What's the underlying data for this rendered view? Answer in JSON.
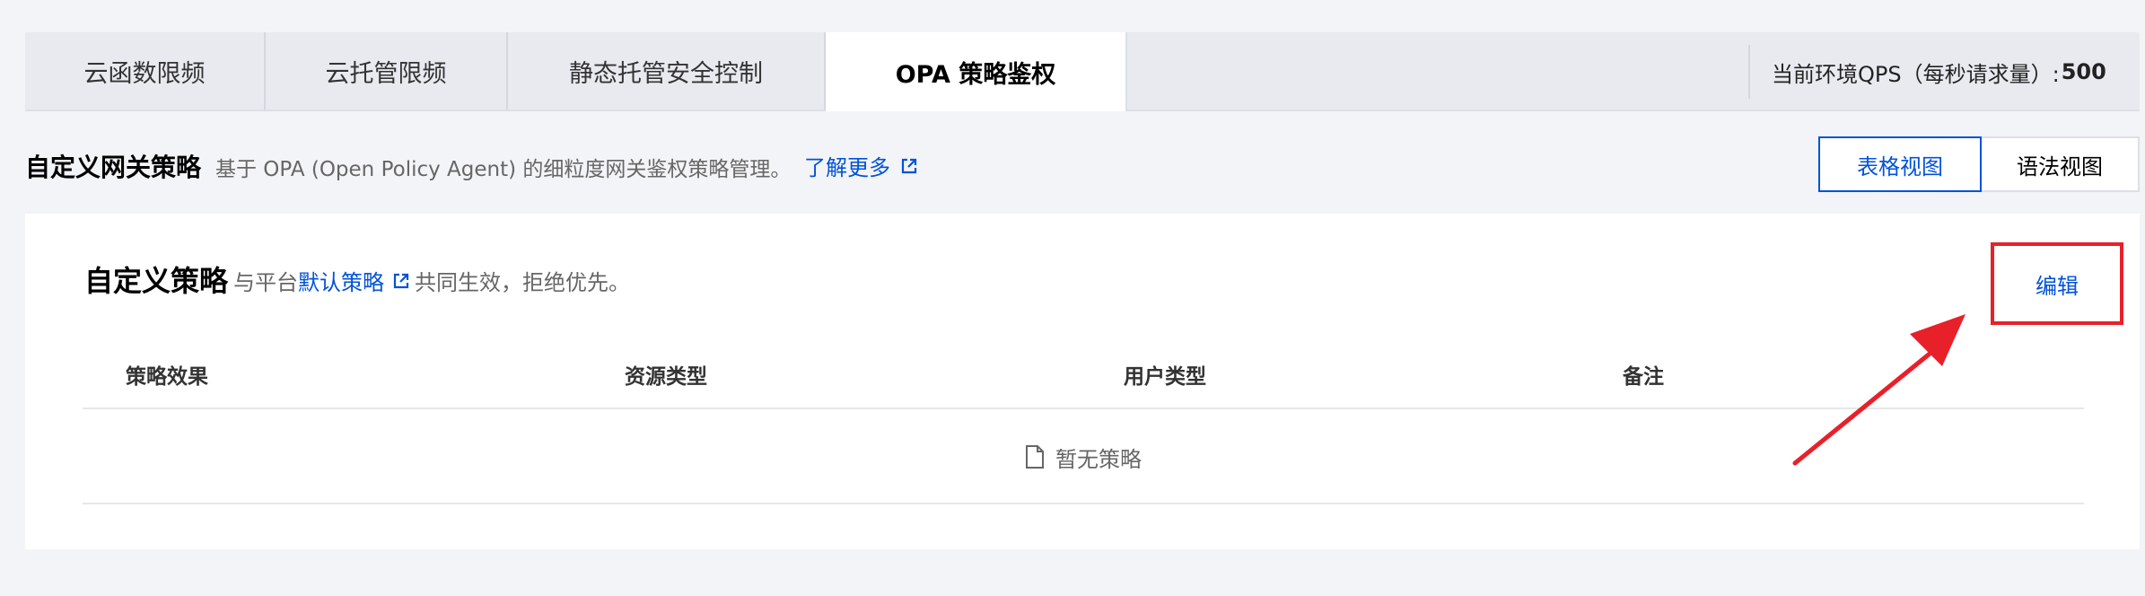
{
  "tabs": [
    {
      "label": "云函数限频",
      "active": false
    },
    {
      "label": "云托管限频",
      "active": false
    },
    {
      "label": "静态托管安全控制",
      "active": false
    },
    {
      "label": "OPA 策略鉴权",
      "active": true
    }
  ],
  "qps": {
    "label": "当前环境QPS（每秒请求量）:",
    "value": "500"
  },
  "section": {
    "title": "自定义网关策略",
    "description": "基于 OPA (Open Policy Agent) 的细粒度网关鉴权策略管理。",
    "learn_more": "了解更多"
  },
  "views": {
    "table": "表格视图",
    "syntax": "语法视图"
  },
  "card": {
    "title": "自定义策略",
    "sub_prefix": "与平台",
    "sub_link": "默认策略",
    "sub_suffix": "共同生效，拒绝优先。",
    "edit": "编辑"
  },
  "table": {
    "columns": [
      "策略效果",
      "资源类型",
      "用户类型",
      "备注"
    ],
    "empty_text": "暂无策略"
  },
  "colors": {
    "accent": "#0052d9",
    "annotation": "#e8202a"
  },
  "icons": [
    "external-link-icon",
    "file-icon",
    "annotation-arrow"
  ]
}
